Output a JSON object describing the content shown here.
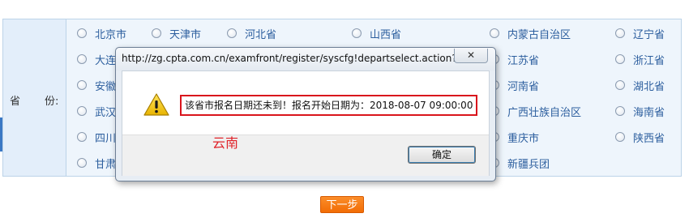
{
  "form": {
    "label_part1": "省",
    "label_part2": "份:",
    "provinces": [
      "北京市",
      "天津市",
      "河北省",
      "山西省",
      "内蒙古自治区",
      "辽宁省",
      "大连",
      "江苏省",
      "浙江省",
      "安徽",
      "河南省",
      "湖北省",
      "武汉",
      "广西壮族自治区",
      "海南省",
      "四川",
      "重庆市",
      "陕西省",
      "甘肃",
      "新疆兵团"
    ]
  },
  "next_button": "下一步",
  "dialog": {
    "title": "http://zg.cpta.com.cn/examfront/register/syscfg!departselect.action?...",
    "close_glyph": "✕",
    "message": "该省市报名日期还未到！报名开始日期为：2018-08-07 09:00:00",
    "ok_label": "确定"
  },
  "annotation": "云南",
  "colors": {
    "warning_icon": "#f2c600",
    "highlight_border": "#d9141c",
    "annotation": "#e0232a",
    "next_button": "#f26d05"
  }
}
